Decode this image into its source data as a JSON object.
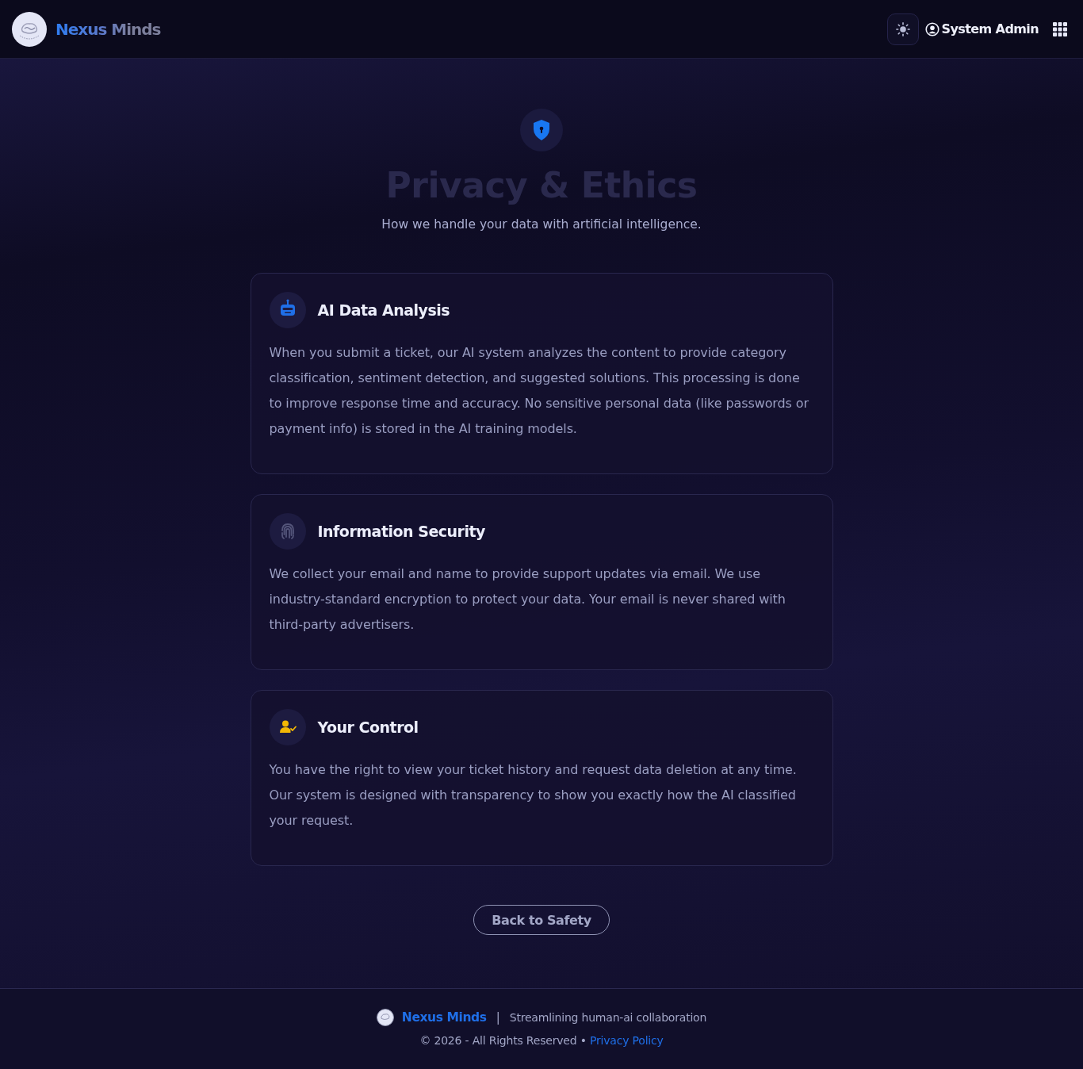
{
  "header": {
    "brand": "Nexus Minds",
    "user": "System Admin"
  },
  "hero": {
    "title": "Privacy & Ethics",
    "subtitle": "How we handle your data with artificial intelligence."
  },
  "sections": [
    {
      "kind": "robot",
      "color": "#1f6fe8",
      "title": "AI Data Analysis",
      "body": "When you submit a ticket, our AI system analyzes the content to provide category classification, sentiment detection, and suggested solutions. This processing is done to improve response time and accuracy. No sensitive personal data (like passwords or payment info) is stored in the AI training models."
    },
    {
      "kind": "fingerprint",
      "color": "#54557a",
      "title": "Information Security",
      "body": "We collect your email and name to provide support updates via email. We use industry-standard encryption to protect your data. Your email is never shared with third-party advertisers."
    },
    {
      "kind": "usercheck",
      "color": "#f2b705",
      "title": "Your Control",
      "body": "You have the right to view your ticket history and request data deletion at any time. Our system is designed with transparency to show you exactly how the AI classified your request."
    }
  ],
  "back_button": "Back to Safety",
  "footer": {
    "brand": "Nexus Minds",
    "separator": "|",
    "tagline": "Streamlining human-ai collaboration",
    "copyright": "© 2026 - All Rights Reserved •",
    "link": "Privacy Policy"
  }
}
